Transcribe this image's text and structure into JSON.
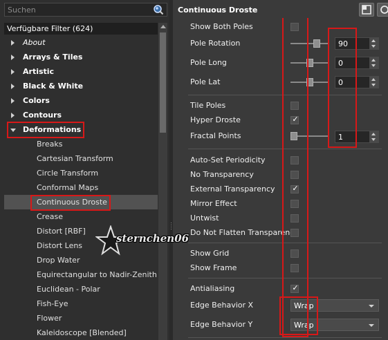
{
  "search": {
    "placeholder": "Suchen"
  },
  "filters": {
    "header": "Verfügbare Filter (624)",
    "categories": [
      {
        "label": "About",
        "italic": true
      },
      {
        "label": "Arrays & Tiles"
      },
      {
        "label": "Artistic"
      },
      {
        "label": "Black & White"
      },
      {
        "label": "Colors"
      },
      {
        "label": "Contours"
      },
      {
        "label": "Deformations",
        "expanded": true
      }
    ],
    "deformations": [
      "Breaks",
      "Cartesian Transform",
      "Circle Transform",
      "Conformal Maps",
      "Continuous Droste",
      "Crease",
      "Distort [RBF]",
      "Distort Lens",
      "Drop Water",
      "Equirectangular to Nadir-Zenith",
      "Euclidean - Polar",
      "Fish-Eye",
      "Flower",
      "Kaleidoscope [Blended]"
    ],
    "selected": "Continuous Droste"
  },
  "panel": {
    "title": "Continuous Droste",
    "params": {
      "show_both_poles": {
        "label": "Show Both Poles",
        "checked": false
      },
      "pole_rotation": {
        "label": "Pole Rotation",
        "value": "90",
        "fraction": 0.72
      },
      "pole_long": {
        "label": "Pole Long",
        "value": "0",
        "fraction": 0.5
      },
      "pole_lat": {
        "label": "Pole Lat",
        "value": "0",
        "fraction": 0.5
      },
      "tile_poles": {
        "label": "Tile Poles",
        "checked": false
      },
      "hyper_droste": {
        "label": "Hyper Droste",
        "checked": true
      },
      "fractal_points": {
        "label": "Fractal Points",
        "value": "1",
        "fraction": 0.0
      },
      "auto_set_periodicity": {
        "label": "Auto-Set Periodicity",
        "checked": false
      },
      "no_transparency": {
        "label": "No Transparency",
        "checked": false
      },
      "external_transparency": {
        "label": "External Transparency",
        "checked": true
      },
      "mirror_effect": {
        "label": "Mirror Effect",
        "checked": false
      },
      "untwist": {
        "label": "Untwist",
        "checked": false
      },
      "do_not_flatten_transparency": {
        "label": "Do Not Flatten Transparency",
        "checked": false
      },
      "show_grid": {
        "label": "Show Grid",
        "checked": false
      },
      "show_frame": {
        "label": "Show Frame",
        "checked": false
      },
      "antialiasing": {
        "label": "Antialiasing",
        "checked": true
      },
      "edge_behavior_x": {
        "label": "Edge Behavior X",
        "value": "Wrap"
      },
      "edge_behavior_y": {
        "label": "Edge Behavior Y",
        "value": "Wrap"
      }
    }
  },
  "watermark": {
    "text": "sternchen06"
  },
  "icons": {
    "search": "search-icon",
    "expand": "triangle-right-icon",
    "collapse": "triangle-down-icon",
    "checkmark": "checkmark-icon",
    "dropdown": "chevron-down-icon",
    "spin_up": "arrow-up-icon",
    "spin_down": "arrow-down-icon",
    "window": "window-icon",
    "star": "star-icon"
  },
  "colors": {
    "highlight": "#d81818",
    "selection": "#525252"
  }
}
